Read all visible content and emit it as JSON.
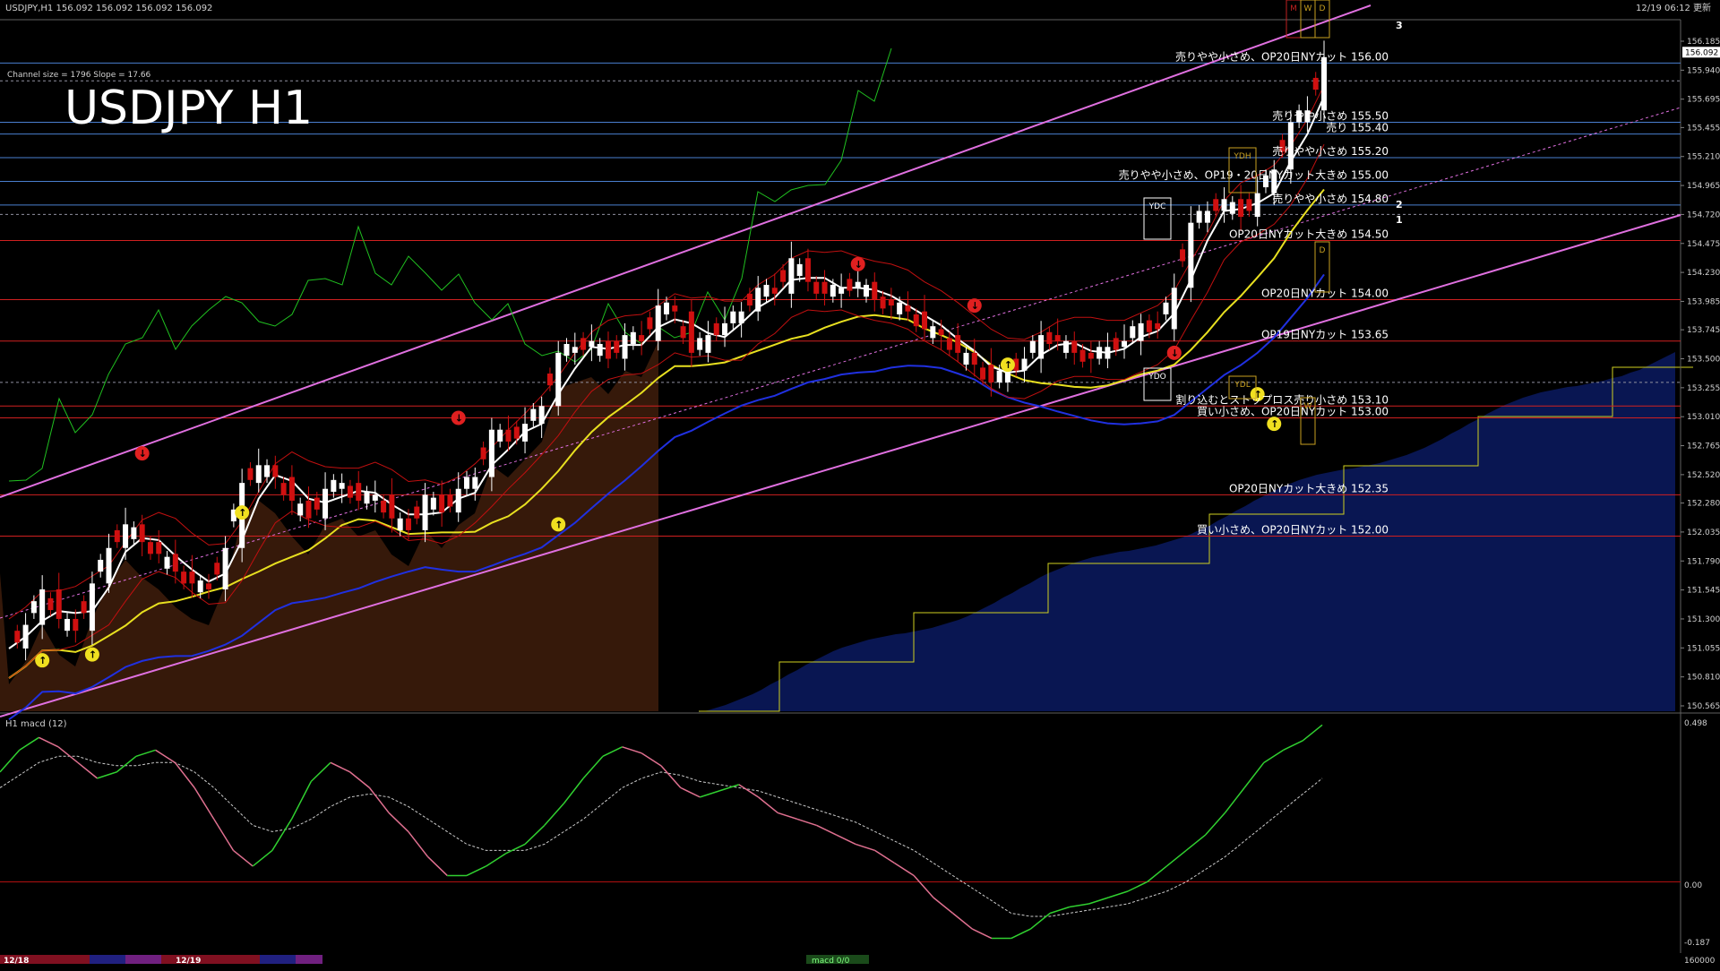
{
  "header": {
    "symbol_info": "USDJPY,H1  156.092 156.092 156.092 156.092",
    "timestamp": "12/19 06:12 更新",
    "channel_info": "Channel size = 1796 Slope = 17.66",
    "big_title": "USDJPY H1"
  },
  "price_axis": {
    "current_price": "156.092",
    "ticks": [
      "156.185",
      "155.940",
      "155.695",
      "155.455",
      "155.210",
      "154.965",
      "154.720",
      "154.475",
      "154.230",
      "153.985",
      "153.745",
      "153.500",
      "153.255",
      "153.010",
      "152.765",
      "152.520",
      "152.280",
      "152.035",
      "151.790",
      "151.545",
      "151.300",
      "151.055",
      "150.810",
      "150.565"
    ]
  },
  "levels": [
    {
      "label": "売りやや小さめ、OP20日NYカット 156.00",
      "price": 156.0,
      "color": "#4a7fd0"
    },
    {
      "label": "売りやや小さめ 155.50",
      "price": 155.5,
      "color": "#4a7fd0"
    },
    {
      "label": "売り 155.40",
      "price": 155.4,
      "color": "#4a7fd0"
    },
    {
      "label": "売りやや小さめ 155.20",
      "price": 155.2,
      "color": "#4a7fd0"
    },
    {
      "label": "売りやや小さめ、OP19・20日NYカット大きめ 155.00",
      "price": 155.0,
      "color": "#4a7fd0"
    },
    {
      "label": "売りやや小さめ 154.80",
      "price": 154.8,
      "color": "#4a7fd0"
    },
    {
      "label": "OP20日NYカット大きめ 154.50",
      "price": 154.5,
      "color": "#d02020"
    },
    {
      "label": "OP20日NYカット 154.00",
      "price": 154.0,
      "color": "#d02020"
    },
    {
      "label": "OP19日NYカット 153.65",
      "price": 153.65,
      "color": "#d02020"
    },
    {
      "label": "割り込むとストップロス売り小さめ 153.10",
      "price": 153.1,
      "color": "#d02020"
    },
    {
      "label": "買い小さめ、OP20日NYカット 153.00",
      "price": 153.0,
      "color": "#d02020"
    },
    {
      "label": "OP20日NYカット大きめ 152.35",
      "price": 152.35,
      "color": "#d02020"
    },
    {
      "label": "買い小さめ、OP20日NYカット 152.00",
      "price": 152.0,
      "color": "#d02020"
    }
  ],
  "boxes": [
    "YDC",
    "YDH",
    "YDL",
    "YDO",
    "M",
    "W",
    "D",
    "D",
    "W"
  ],
  "channel_numbers": [
    "3",
    "2",
    "1"
  ],
  "indicator": {
    "title": "H1  macd (12)",
    "ticks": [
      "0.498",
      "0.00",
      "-0.187"
    ],
    "bottom_value": "160000",
    "bottom_label": "macd 0/0"
  },
  "time_axis": {
    "labels": [
      "12/18",
      "12/19"
    ]
  },
  "colors": {
    "bull": "#ffffff",
    "bear": "#d01010",
    "ma_fast": "#ffffff",
    "ma_mid": "#e8e020",
    "ma_slow": "#2030e0",
    "chikou": "#20c020",
    "channel": "#e070e0",
    "macd_up": "#30d030",
    "macd_down": "#e07090",
    "signal": "#cccccc"
  },
  "icons": [
    "up-arrow-icon",
    "down-arrow-icon"
  ],
  "chart_data": {
    "type": "candlestick",
    "title": "USDJPY H1",
    "timeframe": "H1",
    "ylim": [
      150.565,
      156.185
    ],
    "close_path": [
      151.05,
      151.25,
      151.55,
      151.3,
      151.2,
      151.6,
      151.9,
      152.1,
      151.95,
      151.85,
      151.7,
      151.6,
      151.55,
      151.9,
      152.45,
      152.6,
      152.5,
      152.3,
      152.15,
      152.4,
      152.45,
      152.3,
      152.35,
      152.15,
      152.05,
      152.35,
      152.2,
      152.4,
      152.5,
      152.9,
      152.8,
      152.95,
      153.1,
      153.55,
      153.6,
      153.65,
      153.5,
      153.7,
      153.65,
      153.95,
      153.9,
      153.55,
      153.7,
      153.8,
      153.9,
      154.1,
      154.05,
      154.35,
      154.15,
      154.05,
      154.1,
      154.15,
      154.0,
      153.95,
      153.9,
      153.75,
      153.7,
      153.55,
      153.45,
      153.3,
      153.4,
      153.5,
      153.7,
      153.65,
      153.55,
      153.5,
      153.6,
      153.65,
      153.8,
      153.75,
      154.1,
      154.65,
      154.75,
      154.85,
      154.7,
      154.9,
      155.1,
      155.5,
      155.6,
      156.05
    ],
    "macd": [
      0.35,
      0.42,
      0.46,
      0.43,
      0.38,
      0.33,
      0.35,
      0.4,
      0.42,
      0.38,
      0.3,
      0.2,
      0.1,
      0.05,
      0.1,
      0.2,
      0.32,
      0.38,
      0.35,
      0.3,
      0.22,
      0.16,
      0.08,
      0.02,
      0.02,
      0.05,
      0.09,
      0.12,
      0.18,
      0.25,
      0.33,
      0.4,
      0.43,
      0.41,
      0.37,
      0.3,
      0.27,
      0.29,
      0.31,
      0.27,
      0.22,
      0.2,
      0.18,
      0.15,
      0.12,
      0.1,
      0.06,
      0.02,
      -0.05,
      -0.1,
      -0.15,
      -0.18,
      -0.18,
      -0.15,
      -0.1,
      -0.08,
      -0.07,
      -0.05,
      -0.03,
      0.0,
      0.05,
      0.1,
      0.15,
      0.22,
      0.3,
      0.38,
      0.42,
      0.45,
      0.5
    ],
    "signal": [
      0.3,
      0.34,
      0.38,
      0.4,
      0.4,
      0.38,
      0.37,
      0.37,
      0.38,
      0.38,
      0.35,
      0.3,
      0.24,
      0.18,
      0.16,
      0.17,
      0.2,
      0.24,
      0.27,
      0.28,
      0.27,
      0.24,
      0.2,
      0.16,
      0.12,
      0.1,
      0.1,
      0.1,
      0.12,
      0.16,
      0.2,
      0.25,
      0.3,
      0.33,
      0.35,
      0.34,
      0.32,
      0.31,
      0.3,
      0.29,
      0.27,
      0.25,
      0.23,
      0.21,
      0.19,
      0.16,
      0.13,
      0.1,
      0.06,
      0.02,
      -0.02,
      -0.06,
      -0.1,
      -0.11,
      -0.11,
      -0.1,
      -0.09,
      -0.08,
      -0.07,
      -0.05,
      -0.03,
      0.0,
      0.04,
      0.08,
      0.13,
      0.18,
      0.23,
      0.28,
      0.33
    ],
    "grid": false
  }
}
